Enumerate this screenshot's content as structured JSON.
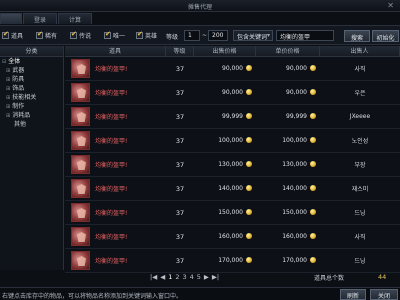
{
  "window": {
    "title": "摊售代理"
  },
  "tabs": [
    {
      "label": "",
      "active": true
    },
    {
      "label": "登录",
      "active": false
    },
    {
      "label": "计算",
      "active": false
    }
  ],
  "filters": {
    "options": [
      {
        "label": "道具",
        "checked": true
      },
      {
        "label": "稀有",
        "checked": true
      },
      {
        "label": "传说",
        "checked": true
      },
      {
        "label": "唯一",
        "checked": true
      },
      {
        "label": "英雄",
        "checked": true
      }
    ],
    "level_label": "等级",
    "level_min": "1",
    "level_sep": "~",
    "level_max": "200",
    "mode_select": "包含关键词",
    "keyword": "均衡的盔甲",
    "search_button": "搜索",
    "reset_button": "初始化"
  },
  "left_panel": {
    "header": "分类",
    "items": [
      {
        "label": "全体",
        "level": 0,
        "selected": true
      },
      {
        "label": "武器",
        "level": 1
      },
      {
        "label": "防具",
        "level": 1
      },
      {
        "label": "饰品",
        "level": 1
      },
      {
        "label": "技能相关",
        "level": 1
      },
      {
        "label": "制作",
        "level": 1
      },
      {
        "label": "消耗品",
        "level": 1
      },
      {
        "label": "其他",
        "level": 1
      }
    ]
  },
  "table": {
    "columns": {
      "item": "道具",
      "level": "等级",
      "price": "出售价格",
      "unit_price": "单价价格",
      "seller": "出售人"
    },
    "rows": [
      {
        "name": "均衡的盔甲!",
        "level": "37",
        "price": "90,000",
        "unit_price": "90,000",
        "seller": "사직"
      },
      {
        "name": "均衡的盔甲!",
        "level": "37",
        "price": "90,000",
        "unit_price": "90,000",
        "seller": "우은"
      },
      {
        "name": "均衡的盔甲!",
        "level": "37",
        "price": "99,999",
        "unit_price": "99,999",
        "seller": "JXeeee"
      },
      {
        "name": "均衡的盔甲!",
        "level": "37",
        "price": "100,000",
        "unit_price": "100,000",
        "seller": "노인성"
      },
      {
        "name": "均衡的盔甲!",
        "level": "37",
        "price": "130,000",
        "unit_price": "130,000",
        "seller": "부장"
      },
      {
        "name": "均衡的盔甲!",
        "level": "37",
        "price": "140,000",
        "unit_price": "140,000",
        "seller": "재스미"
      },
      {
        "name": "均衡的盔甲!",
        "level": "37",
        "price": "150,000",
        "unit_price": "150,000",
        "seller": "드닝"
      },
      {
        "name": "均衡的盔甲!",
        "level": "37",
        "price": "160,000",
        "unit_price": "160,000",
        "seller": "사직"
      },
      {
        "name": "均衡的盔甲!",
        "level": "37",
        "price": "170,000",
        "unit_price": "170,000",
        "seller": "드닝"
      }
    ]
  },
  "pager": {
    "first": "|◀",
    "prev": "◀",
    "pages": [
      "1",
      "2",
      "3",
      "4",
      "5"
    ],
    "next": "▶",
    "last": "▶|",
    "current": "1"
  },
  "footer": {
    "total_label": "道具总个数",
    "total_value": "44",
    "status_tip": "右键点击库存中的物品，可以将物品名称添加到关键词输入窗口中。",
    "refresh_button": "刷新",
    "close_button": "关闭"
  },
  "colors": {
    "item_name": "#e46060",
    "coin": "#e0b22a",
    "accent": "#e7c35a"
  }
}
